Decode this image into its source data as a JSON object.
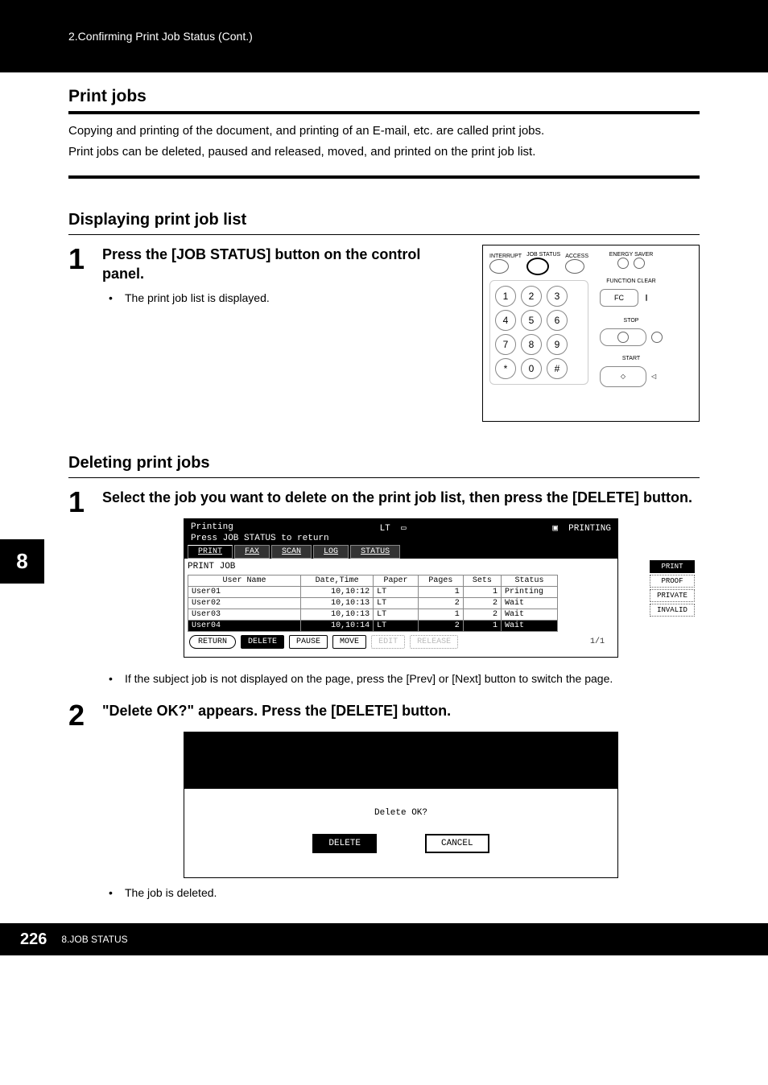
{
  "header": {
    "breadcrumb": "2.Confirming Print Job Status (Cont.)"
  },
  "sections": {
    "print_jobs": {
      "title": "Print jobs",
      "para1": "Copying and printing of the document, and printing of an E-mail, etc. are called print jobs.",
      "para2": "Print jobs can be deleted, paused and released, moved, and printed on the print job list."
    },
    "display_list": {
      "title": "Displaying print job list"
    },
    "deleting": {
      "title": "Deleting print jobs"
    }
  },
  "side_tab": "8",
  "steps": {
    "s1": {
      "num": "1",
      "text": "Press the [JOB STATUS] button on the control panel.",
      "bullet": "The print job list is displayed."
    },
    "del1": {
      "num": "1",
      "text": "Select the job you want to delete on the print job list, then press the [DELETE] button.",
      "bullet": "If the subject job is not displayed on the page, press the [Prev] or [Next] button to switch the page."
    },
    "del2": {
      "num": "2",
      "text": "\"Delete OK?\" appears. Press the [DELETE] button.",
      "bullet": "The job is deleted."
    }
  },
  "control_panel": {
    "labels": {
      "interrupt": "INTERRUPT",
      "job_status": "JOB STATUS",
      "access": "ACCESS",
      "energy": "ENERGY SAVER",
      "func_clear": "FUNCTION CLEAR",
      "fc": "FC",
      "stop": "STOP",
      "start": "START"
    },
    "keys": [
      "1",
      "2",
      "3",
      "4",
      "5",
      "6",
      "7",
      "8",
      "9",
      "*",
      "0",
      "#"
    ]
  },
  "screen1": {
    "title": "Printing",
    "paper": "LT",
    "status_icon": "PRINTING",
    "hint": "Press JOB STATUS to return",
    "tabs": [
      "PRINT",
      "FAX",
      "SCAN",
      "LOG",
      "STATUS"
    ],
    "subheader": "PRINT JOB",
    "columns": [
      "User Name",
      "Date,Time",
      "Paper",
      "Pages",
      "Sets",
      "Status"
    ],
    "rows": [
      {
        "user": "User01",
        "dt": "10,10:12",
        "paper": "LT",
        "pages": "1",
        "sets": "1",
        "status": "Printing"
      },
      {
        "user": "User02",
        "dt": "10,10:13",
        "paper": "LT",
        "pages": "2",
        "sets": "2",
        "status": "Wait"
      },
      {
        "user": "User03",
        "dt": "10,10:13",
        "paper": "LT",
        "pages": "1",
        "sets": "2",
        "status": "Wait"
      },
      {
        "user": "User04",
        "dt": "10,10:14",
        "paper": "LT",
        "pages": "2",
        "sets": "1",
        "status": "Wait"
      }
    ],
    "side_btns": [
      "PRINT",
      "PROOF",
      "PRIVATE",
      "INVALID"
    ],
    "bottom_btns": {
      "return": "RETURN",
      "delete": "DELETE",
      "pause": "PAUSE",
      "move": "MOVE",
      "edit": "EDIT",
      "release": "RELEASE"
    },
    "page": "1/1"
  },
  "screen2": {
    "prompt": "Delete OK?",
    "delete": "DELETE",
    "cancel": "CANCEL"
  },
  "footer": {
    "page": "226",
    "chapter": "8.JOB STATUS"
  }
}
